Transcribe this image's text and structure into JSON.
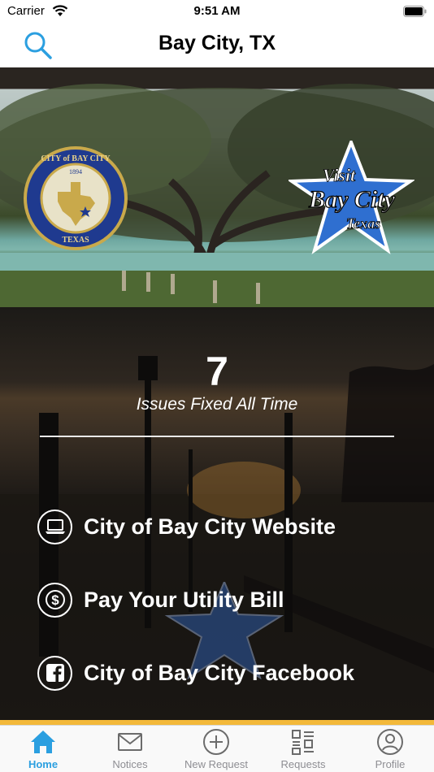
{
  "status_bar": {
    "carrier": "Carrier",
    "time": "9:51 AM"
  },
  "nav": {
    "title": "Bay City, TX",
    "search_icon": "search-icon"
  },
  "hero": {
    "seal_top": "CITY of BAY CITY",
    "seal_year": "1894",
    "seal_bottom": "TEXAS",
    "visit_line1": "Visit",
    "visit_line2": "Bay City",
    "visit_line3": "Texas"
  },
  "stats": {
    "count": "7",
    "label": "Issues Fixed All Time"
  },
  "links": [
    {
      "label": "City of Bay City Website",
      "icon": "laptop-icon"
    },
    {
      "label": "Pay Your Utility Bill",
      "icon": "dollar-icon"
    },
    {
      "label": "City of Bay City Facebook",
      "icon": "facebook-icon"
    }
  ],
  "tabs": [
    {
      "label": "Home",
      "icon": "home-icon",
      "active": true
    },
    {
      "label": "Notices",
      "icon": "envelope-icon",
      "active": false
    },
    {
      "label": "New Request",
      "icon": "plus-circle-icon",
      "active": false
    },
    {
      "label": "Requests",
      "icon": "list-icon",
      "active": false
    },
    {
      "label": "Profile",
      "icon": "user-circle-icon",
      "active": false
    }
  ],
  "colors": {
    "accent": "#2b9fe0",
    "gold": "#f3b93a",
    "inactive": "#8e8e93"
  }
}
